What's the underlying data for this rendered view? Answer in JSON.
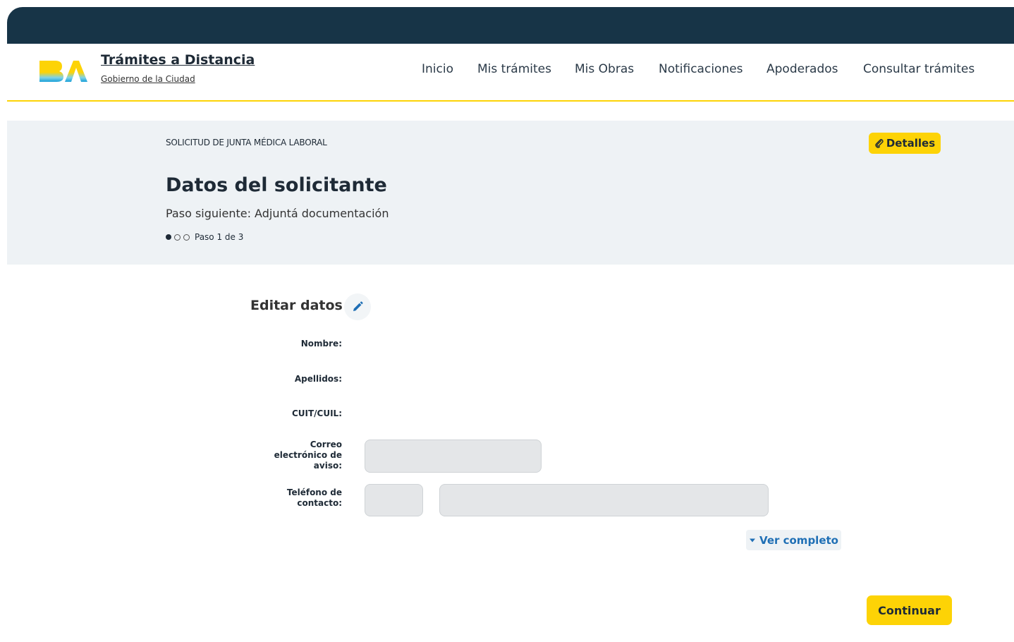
{
  "header": {
    "brand_title": "Trámites a Distancia",
    "brand_subtitle": "Gobierno de la Ciudad",
    "nav": [
      "Inicio",
      "Mis trámites",
      "Mis Obras",
      "Notificaciones",
      "Apoderados",
      "Consultar trámites"
    ]
  },
  "banner": {
    "procedure_name": "SOLICITUD DE JUNTA MÉDICA LABORAL",
    "details_label": "Detalles",
    "title": "Datos del solicitante",
    "next_step": "Paso siguiente: Adjuntá documentación",
    "step_text": "Paso 1 de 3",
    "current_step": 1,
    "total_steps": 3
  },
  "form": {
    "section_title": "Editar datos",
    "labels": {
      "nombre": "Nombre:",
      "apellidos": "Apellidos:",
      "cuit": "CUIT/CUIL:",
      "email_1": "Correo",
      "email_2": "electrónico de",
      "email_3": "aviso:",
      "phone_1": "Teléfono de",
      "phone_2": "contacto:"
    },
    "email_value": "",
    "phone_area_value": "",
    "phone_number_value": "",
    "ver_completo": "Ver completo",
    "continue_label": "Continuar"
  },
  "colors": {
    "topbar": "#173447",
    "accent_yellow": "#fdd306",
    "link_blue": "#1f6fb5"
  },
  "icons": {
    "logo": "ba-logo",
    "details": "paperclip-icon",
    "edit": "pencil-icon",
    "expand": "caret-down-icon"
  }
}
